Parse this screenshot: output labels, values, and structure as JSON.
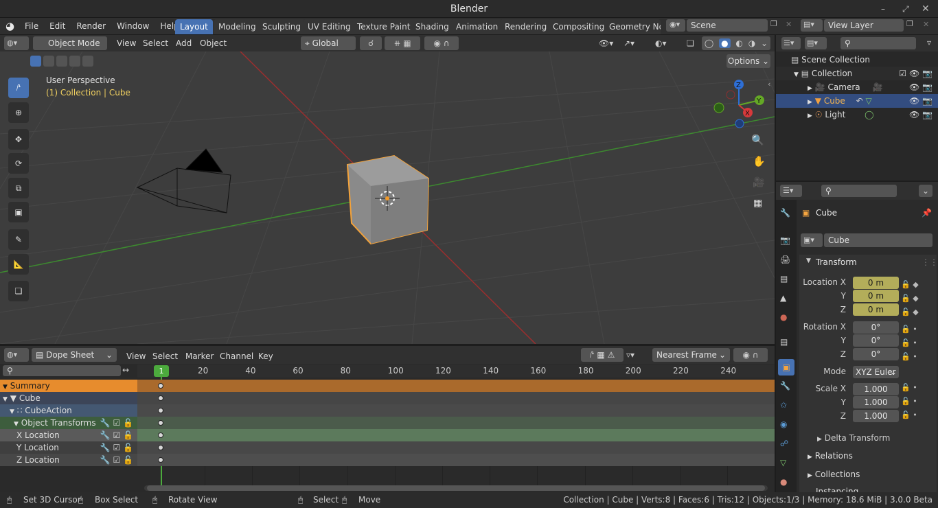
{
  "app_title": "Blender",
  "menu": [
    "File",
    "Edit",
    "Render",
    "Window",
    "Help"
  ],
  "workspaces": [
    "Layout",
    "Modeling",
    "Sculpting",
    "UV Editing",
    "Texture Paint",
    "Shading",
    "Animation",
    "Rendering",
    "Compositing",
    "Geometry Nod"
  ],
  "scene": "Scene",
  "view_layer": "View Layer",
  "viewport": {
    "mode": "Object Mode",
    "menus": [
      "View",
      "Select",
      "Add",
      "Object"
    ],
    "orientation": "Global",
    "options": "Options",
    "perspective": "User Perspective",
    "collection_info": "(1) Collection | Cube",
    "axes": {
      "x": "X",
      "y": "Y",
      "z": "Z"
    }
  },
  "outliner": {
    "scene_collection": "Scene Collection",
    "collection": "Collection",
    "camera": "Camera",
    "cube": "Cube",
    "light": "Light"
  },
  "properties": {
    "object_name": "Cube",
    "name_field": "Cube",
    "transform": "Transform",
    "location_x_label": "Location X",
    "location_x": "0 m",
    "y_label": "Y",
    "z_label": "Z",
    "location_y": "0 m",
    "location_z": "0 m",
    "rotation_x_label": "Rotation X",
    "rotation_x": "0°",
    "rotation_y": "0°",
    "rotation_z": "0°",
    "mode_label": "Mode",
    "mode": "XYZ Euler",
    "scale_x_label": "Scale X",
    "scale_x": "1.000",
    "scale_y": "1.000",
    "scale_z": "1.000",
    "delta_transform": "Delta Transform",
    "relations": "Relations",
    "collections": "Collections",
    "instancing": "Instancing"
  },
  "dopesheet": {
    "mode": "Dope Sheet",
    "menus": [
      "View",
      "Select",
      "Marker",
      "Channel",
      "Key"
    ],
    "snap": "Nearest Frame",
    "current_frame": "1",
    "ticks": [
      "20",
      "40",
      "60",
      "80",
      "100",
      "120",
      "140",
      "160",
      "180",
      "200",
      "220",
      "240"
    ],
    "channels": {
      "summary": "Summary",
      "cube": "Cube",
      "action": "CubeAction",
      "group": "Object Transforms",
      "x": "X Location",
      "y": "Y Location",
      "z": "Z Location"
    }
  },
  "status": {
    "cursor": "Set 3D Cursor",
    "box": "Box Select",
    "rotate": "Rotate View",
    "select": "Select",
    "move": "Move",
    "info": "Collection | Cube | Verts:8 | Faces:6 | Tris:12 | Objects:1/3 | Memory: 18.6 MiB | 3.0.0 Beta"
  }
}
